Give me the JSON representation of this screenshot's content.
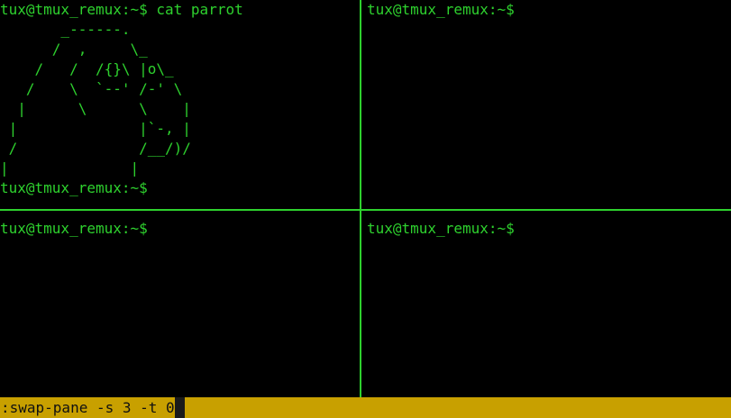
{
  "panes": [
    {
      "index": 0,
      "lines": [
        "tux@tmux_remux:~$ cat parrot",
        "       _------.",
        "      /  ,     \\_",
        "    /   /  /{}\\ |o\\_",
        "   /    \\  `--' /-' \\",
        "  |      \\      \\    |",
        " |              |`-, |",
        " /              /__/)/",
        "|              |",
        "tux@tmux_remux:~$"
      ]
    },
    {
      "index": 1,
      "lines": [
        "tux@tmux_remux:~$"
      ]
    },
    {
      "index": 2,
      "lines": [
        "tux@tmux_remux:~$"
      ]
    },
    {
      "index": 3,
      "lines": [
        "tux@tmux_remux:~$"
      ]
    }
  ],
  "status_bar": {
    "command": ":swap-pane -s 3 -t 0"
  },
  "colors": {
    "terminal_bg": "#000000",
    "text": "#2ed12e",
    "pane_border": "#2ed12e",
    "status_bg": "#c8a000",
    "status_text": "#111111"
  }
}
